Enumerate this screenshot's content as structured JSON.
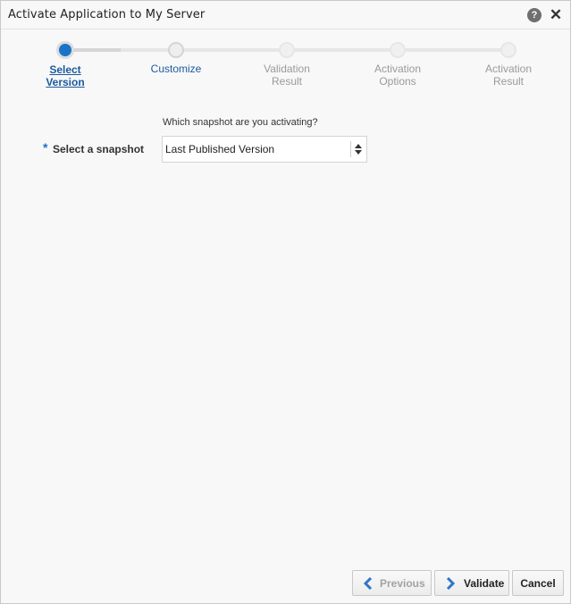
{
  "dialog": {
    "title": "Activate Application to My Server",
    "help_glyph": "?",
    "close_glyph": "✕"
  },
  "train": {
    "steps": [
      {
        "line1": "Select",
        "line2": "Version",
        "state": "current"
      },
      {
        "line1": "Customize",
        "line2": "",
        "state": "next"
      },
      {
        "line1": "Validation",
        "line2": "Result",
        "state": "disabled"
      },
      {
        "line1": "Activation",
        "line2": "Options",
        "state": "disabled"
      },
      {
        "line1": "Activation",
        "line2": "Result",
        "state": "disabled"
      }
    ]
  },
  "form": {
    "question": "Which snapshot are you activating?",
    "required_marker": "*",
    "snapshot_label": "Select a snapshot",
    "snapshot_value": "Last Published Version"
  },
  "footer": {
    "previous_label": "Previous",
    "validate_label": "Validate",
    "cancel_label": "Cancel"
  },
  "colors": {
    "accent": "#1a73c9",
    "link": "#1b5a9c",
    "disabled_text": "#9a9a9a"
  }
}
